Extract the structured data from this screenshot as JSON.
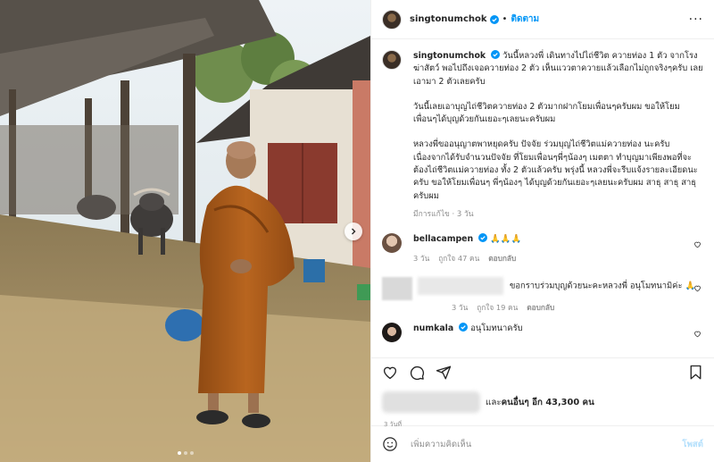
{
  "header": {
    "username": "singtonumchok",
    "separator": "•",
    "follow_label": "ติดตาม",
    "more_label": "···"
  },
  "caption": {
    "username": "singtonumchok",
    "paragraph1": "วันนี้หลวงพี่ เดินทางไปไถ่ชีวิต ควายท่อง 1 ตัว จากโรงฆ่าสัตว์ พอไปถึงเจอควายท่อง 2 ตัว เห็นแววตาควายแล้วเลือกไม่ถูกจริงๆครับ เลยเอามา 2 ตัวเลยครับ",
    "paragraph2": "วันนี้เลยเอาบุญไถ่ชีวิตควายท่อง 2 ตัวมากฝากโยมเพื่อนๆครับผม ขอให้โยมเพื่อนๆได้บุญด้วยกันเยอะๆเลยนะครับผม",
    "paragraph3": "หลวงพี่ขออนุญาตพาหยุดครับ ปัจจัย ร่วมบุญไถ่ชีวิตแม่ควายท่อง นะครับ เนื่องจากได้รับจำนวนปัจจัย ที่โยมเพื่อนๆพี่ๆน้องๆ เมตตา ทำบุญมาเพียงพอที่จะต้องไถ่ชีวิตแม่ควายท่อง ทั้ง 2 ตัวแล้วครับ พรุ่งนี้ หลวงพี่จะรีบแจ้งรายละเอียดนะครับ ขอให้โยมเพื่อนๆ พี่ๆน้องๆ ได้บุญด้วยกันเยอะๆเลยนะครับผม สาธุ สาธุ สาธุ ครับผม",
    "meta": "มีการแก้ไข · 3 วัน"
  },
  "comments": [
    {
      "username": "bellacampen",
      "text": "🙏🙏🙏",
      "time": "3 วัน",
      "likes": "ถูกใจ 47 คน",
      "reply": "ตอบกลับ"
    },
    {
      "username": "",
      "text": "ขอกราบร่วมบุญด้วยนะคะหลวงพี่ อนุโมทนามิค่ะ 🙏",
      "time": "3 วัน",
      "likes": "ถูกใจ 19 คน",
      "reply": "ตอบกลับ"
    },
    {
      "username": "numkala",
      "text": "อนุโมทนาครับ"
    }
  ],
  "likes": {
    "text_prefix": "และ",
    "text_bold": "คนอื่นๆ อีก 43,300 คน",
    "time": "3 วันที่"
  },
  "add_comment": {
    "placeholder": "เพิ่มความคิดเห็น",
    "post_label": "โพสต์"
  },
  "carousel": {
    "count": 3,
    "active": 1
  },
  "colors": {
    "accent": "#0095f6",
    "verified": "#0095f6",
    "robe": "#b0611c"
  }
}
